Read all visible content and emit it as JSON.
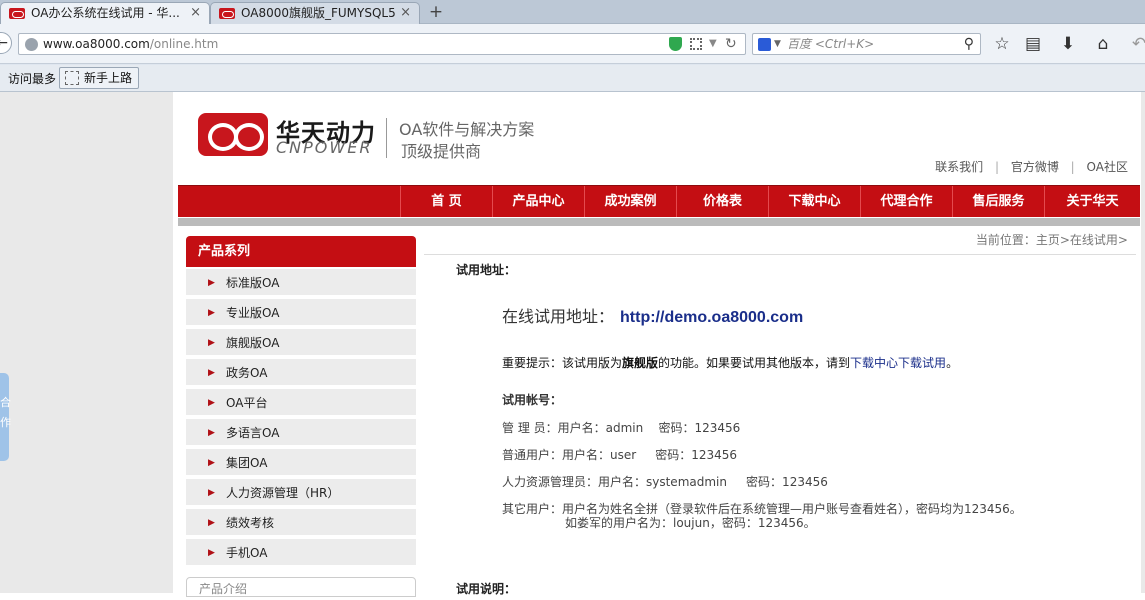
{
  "browser": {
    "tabs": [
      {
        "title": "OA办公系统在线试用 - 华...",
        "close": "×"
      },
      {
        "title": "OA8000旗舰版_FUMYSQL5",
        "close": "×"
      }
    ],
    "new_tab": "+",
    "url_host": "www.oa8000.com",
    "url_path": "/online.htm",
    "search_placeholder": "百度 <Ctrl+K>",
    "bookmarks": [
      "访问最多",
      "新手上路"
    ]
  },
  "site": {
    "brand_cn": "华天动力",
    "brand_en": "CNPOWER",
    "slogan_line1": "OA软件与解决方案",
    "slogan_line2": "顶级提供商",
    "top_links": [
      "联系我们",
      "官方微博",
      "OA社区"
    ],
    "top_link_sep": "|",
    "nav": [
      "首 页",
      "产品中心",
      "成功案例",
      "价格表",
      "下载中心",
      "代理合作",
      "售后服务",
      "关于华天"
    ],
    "side_handle": "合\n作",
    "left_panel": {
      "title": "产品系列",
      "items": [
        "标准版OA",
        "专业版OA",
        "旗舰版OA",
        "政务OA",
        "OA平台",
        "多语言OA",
        "集团OA",
        "人力资源管理（HR）",
        "绩效考核",
        "手机OA"
      ],
      "next_title": "产品介绍"
    },
    "breadcrumb": "当前位置：主页>在线试用>",
    "trial_address_heading": "试用地址：",
    "online_label": "在线试用地址：",
    "online_url": "http://demo.oa8000.com",
    "notice_prefix": "重要提示：该试用版为",
    "notice_bold": "旗舰版",
    "notice_middle": "的功能。如果要试用其他版本，请到",
    "notice_link": "下载中心下载试用",
    "notice_suffix": "。",
    "accounts_title": "试用帐号：",
    "accounts": [
      "管 理 员：用户名：admin    密码：123456",
      "普通用户：用户名：user     密码：123456",
      "人力资源管理员：用户名：systemadmin     密码：123456",
      "其它用户：用户名为姓名全拼（登录软件后在系统管理—用户账号查看姓名），密码均为123456。"
    ],
    "accounts_example": "如娄军的用户名为：loujun，密码：123456。",
    "desc_heading": "试用说明："
  }
}
